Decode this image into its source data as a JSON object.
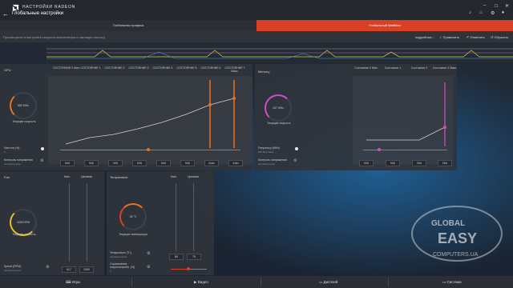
{
  "app": {
    "title": "НАСТРОЙКИ RADEON",
    "page_title": "Глобальные настройки",
    "back_icon": "back-arrow-icon",
    "logo_icon": "amd-logo-icon"
  },
  "window_controls": [
    "minimize-icon",
    "maximize-icon",
    "close-icon"
  ],
  "tabs": [
    {
      "label": "Глобальная графика",
      "active": false
    },
    {
      "label": "Глобальный WattMan",
      "active": true
    }
  ],
  "actionbar": {
    "hint": "Просмотрите и настройте скорость вентилятора и тактовую частоту.",
    "profile": "подробные...",
    "apply": "Применить",
    "discard": "Отменить",
    "reset": "Сбросить"
  },
  "gpu": {
    "label": "GPU",
    "states": [
      "СОСТОЯНИЕ 0 Мин.",
      "СОСТОЯНИЕ 1",
      "СОСТОЯНИЕ 2",
      "СОСТОЯНИЕ 3",
      "СОСТОЯНИЕ 4",
      "СОСТОЯНИЕ 5",
      "СОСТОЯНИЕ 6",
      "СОСТОЯНИЕ 7 Макс."
    ],
    "gauge_value": "852 MHz",
    "gauge_caption": "Текущая скорость",
    "frequency_label": "Частота (%)",
    "frequency_value": "0",
    "voltage_label": "Контроль напряжения",
    "voltage_value": "Автоматически",
    "cells": [
      "N/A",
      "N/A",
      "N/A",
      "N/A",
      "N/A",
      "N/A",
      "Auto",
      "Auto"
    ],
    "slider_percent": 49
  },
  "memory": {
    "label": "Memory",
    "states": [
      "Состояние 0 Мин.",
      "Состояние 1",
      "Состояние 2",
      "Состояние 3 Макс."
    ],
    "gauge_value": "167 MHz",
    "gauge_caption": "Текущая скорость",
    "frequency_label": "Frequency (MHz)",
    "frequency_value": "990 MHz Макс.",
    "voltage_label": "Контроль напряжения",
    "voltage_value": "Автоматически",
    "cells": [
      "N/A",
      "N/A",
      "N/A",
      "N/A"
    ],
    "slider_percent": 19
  },
  "fan": {
    "label": "Fan",
    "col_min": "Мин.",
    "col_target": "Целевая",
    "gauge_value": "1155 RPM",
    "gauge_caption": "Текущая скорость",
    "speed_label": "Speed (RPM)",
    "speed_value": "Автоматически",
    "min_value": "617",
    "target_value": "2000"
  },
  "temperature": {
    "label": "Temperature",
    "col_min": "Мин.",
    "col_target": "Целевая",
    "gauge_value": "33 °C",
    "gauge_caption": "Текущая температура",
    "temp_label": "Temperature (°C)",
    "temp_value": "Автоматически",
    "power_label": "Ограничение энергопотребл. (%)",
    "power_value": "0",
    "min_value": "80",
    "target_value": "75"
  },
  "bottom_nav": [
    {
      "label": "Игры",
      "icon": "gamepad-icon"
    },
    {
      "label": "Видео",
      "icon": "play-icon"
    },
    {
      "label": "Дисплей",
      "icon": "monitor-icon"
    },
    {
      "label": "Система",
      "icon": "monitor-icon"
    }
  ],
  "watermark": {
    "line1": "GLOBAL",
    "line2": "EASY",
    "line3": "COMPUTERS.UA"
  },
  "colors": {
    "accent": "#d94026",
    "orange": "#e8731a",
    "pink": "#d14fc3"
  }
}
